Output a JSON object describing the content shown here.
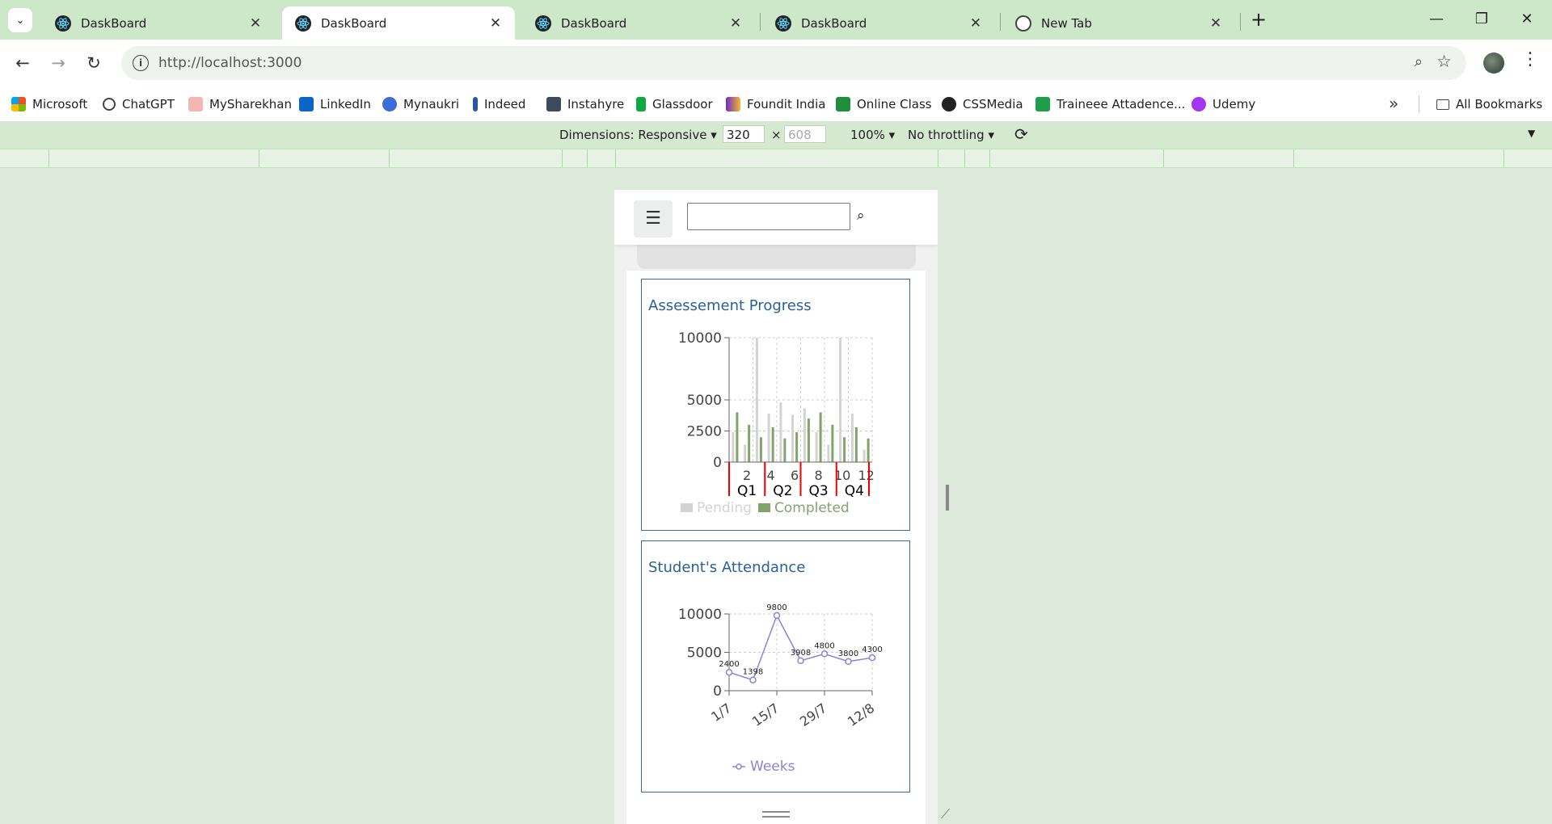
{
  "tabs": [
    {
      "title": "DaskBoard",
      "icon": "react-icon",
      "active": false
    },
    {
      "title": "DaskBoard",
      "icon": "react-icon",
      "active": true
    },
    {
      "title": "DaskBoard",
      "icon": "react-icon",
      "active": false
    },
    {
      "title": "DaskBoard",
      "icon": "react-icon",
      "active": false
    },
    {
      "title": "New Tab",
      "icon": "chrome-icon",
      "active": false
    }
  ],
  "toolbar": {
    "url": "http://localhost:3000"
  },
  "bookmarks": [
    {
      "label": "Microsoft"
    },
    {
      "label": "ChatGPT"
    },
    {
      "label": "MySharekhan"
    },
    {
      "label": "LinkedIn"
    },
    {
      "label": "Mynaukri"
    },
    {
      "label": "Indeed"
    },
    {
      "label": "Instahyre"
    },
    {
      "label": "Glassdoor"
    },
    {
      "label": "Foundit India"
    },
    {
      "label": "Online Class"
    },
    {
      "label": "CSSMedia"
    },
    {
      "label": "Traineee Attadence..."
    },
    {
      "label": "Udemy"
    }
  ],
  "all_bookmarks": "All Bookmarks",
  "devtools": {
    "dimensions_label": "Dimensions: Responsive ▾",
    "width": "320",
    "times": "×",
    "height": "608",
    "zoom": "100% ▾",
    "throttling": "No throttling ▾"
  },
  "colors": {
    "pending": "#d3d3d3",
    "completed": "#82a46c",
    "attendance": "#8884d8",
    "card_border": "#3b6aa0",
    "title": "#2b5f95"
  },
  "chart_data": [
    {
      "type": "bar",
      "title": "Assessement Progress",
      "x": [
        1,
        2,
        3,
        4,
        5,
        6,
        7,
        8,
        9,
        10,
        11,
        12
      ],
      "series": [
        {
          "name": "Pending",
          "values": [
            2400,
            1400,
            10000,
            3900,
            4800,
            3800,
            4300,
            2400,
            1400,
            10000,
            3900,
            1000
          ]
        },
        {
          "name": "Completed",
          "values": [
            4000,
            3000,
            2000,
            2800,
            1900,
            2400,
            3500,
            4000,
            3000,
            2000,
            2800,
            1900
          ]
        }
      ],
      "x_tick_labels": [
        "2",
        "4",
        "6",
        "8",
        "10",
        "12"
      ],
      "quarter_labels": [
        "Q1",
        "Q2",
        "Q3",
        "Q4"
      ],
      "y_ticks": [
        "0",
        "2500",
        "5000",
        "10000"
      ],
      "ylim": [
        0,
        10000
      ],
      "grid": true,
      "legend": "bottom"
    },
    {
      "type": "line",
      "title": "Student's Attendance",
      "x": [
        "1/7",
        "8/7",
        "15/7",
        "22/7",
        "29/7",
        "5/8",
        "12/8"
      ],
      "x_tick_labels": [
        "1/7",
        "15/7",
        "29/7",
        "12/8"
      ],
      "series": [
        {
          "name": "Weeks",
          "values": [
            2400,
            1398,
            9800,
            3908,
            4800,
            3800,
            4300
          ]
        }
      ],
      "data_labels": [
        "2400",
        "1398",
        "9800",
        "3908",
        "4800",
        "3800",
        "4300"
      ],
      "y_ticks": [
        "0",
        "5000",
        "10000"
      ],
      "ylim": [
        0,
        10000
      ],
      "grid": true,
      "legend": "bottom"
    }
  ]
}
